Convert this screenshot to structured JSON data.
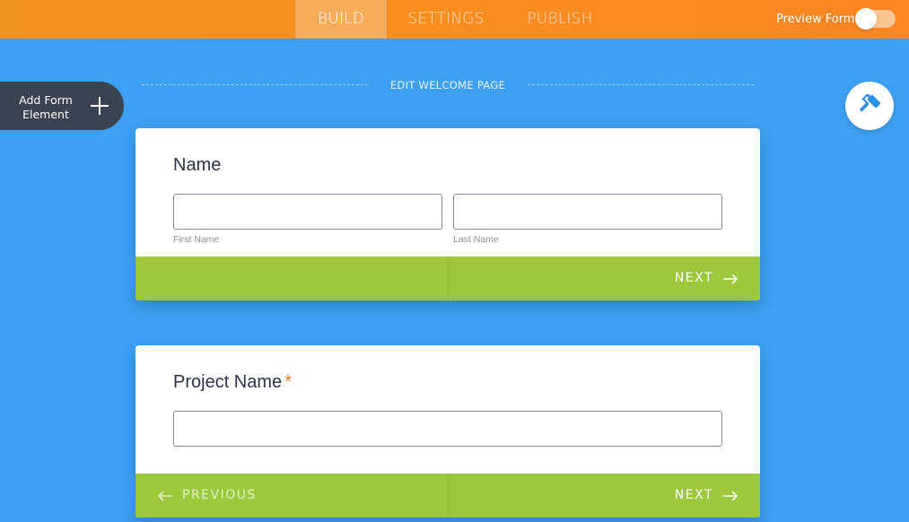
{
  "topbar": {
    "tabs": [
      {
        "label": "BUILD",
        "active": true
      },
      {
        "label": "SETTINGS",
        "active": false
      },
      {
        "label": "PUBLISH",
        "active": false
      }
    ],
    "preview_label": "Preview Form",
    "preview_enabled": false
  },
  "sidebar": {
    "add_element_label": "Add Form Element",
    "add_icon": "plus-icon"
  },
  "canvas": {
    "edit_welcome_label": "EDIT WELCOME PAGE",
    "designer_icon": "paint-roller-icon"
  },
  "cards": [
    {
      "question": "Name",
      "required": false,
      "fields": [
        {
          "value": "",
          "sublabel": "First Name"
        },
        {
          "value": "",
          "sublabel": "Last Name"
        }
      ],
      "next_label": "NEXT"
    },
    {
      "question": "Project Name",
      "required": true,
      "required_mark": "*",
      "fields": [
        {
          "value": ""
        }
      ],
      "previous_label": "PREVIOUS",
      "next_label": "NEXT"
    }
  ],
  "colors": {
    "background": "#3da0f2",
    "topbar": "#f98c20",
    "footer_green": "#9dc73d",
    "required_star": "#f07a1d",
    "sidebar_button": "#3a4350"
  }
}
